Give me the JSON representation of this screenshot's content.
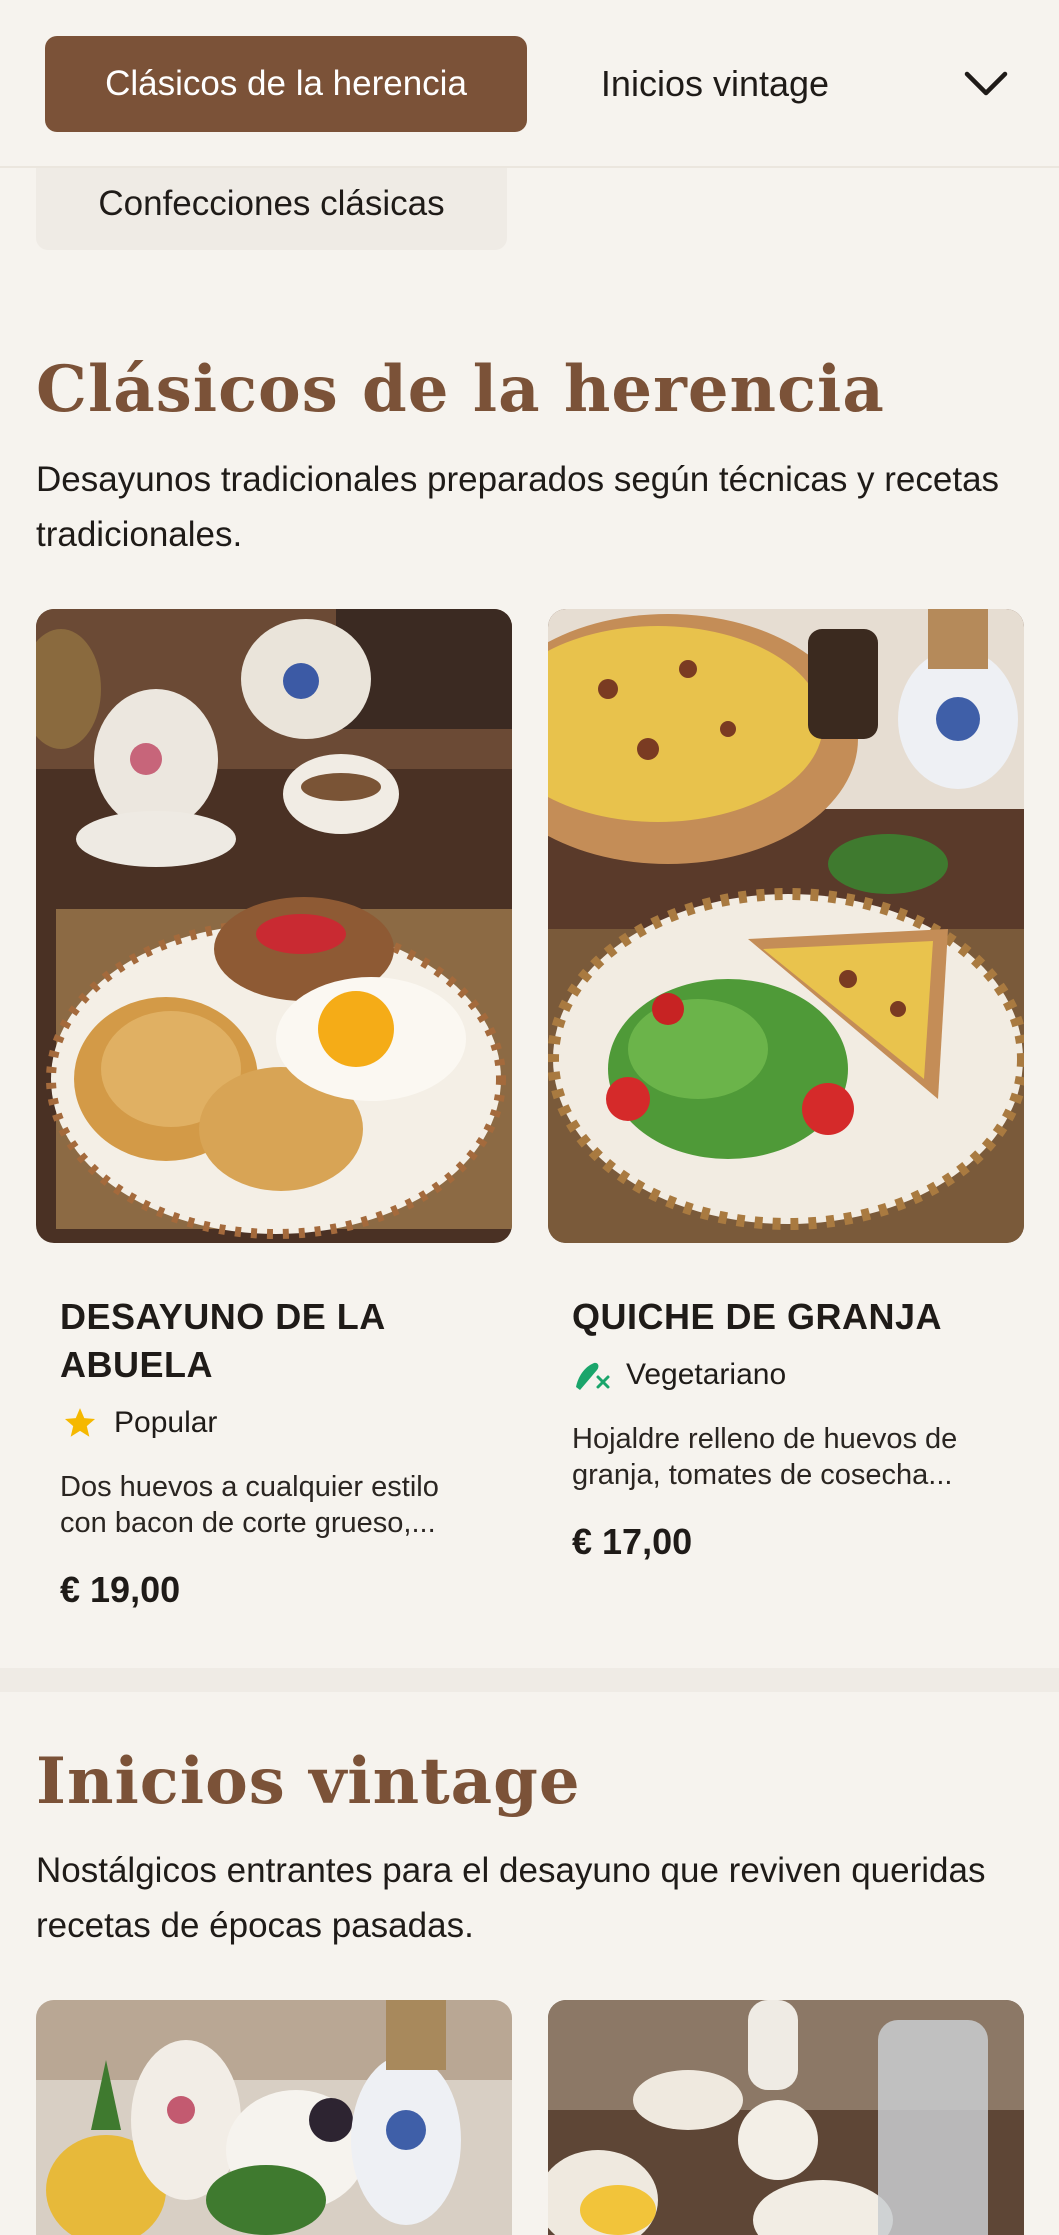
{
  "nav": {
    "active_tab": "Clásicos de la herencia",
    "tab_2": "Inicios vintage",
    "tab_3": "Confecciones clásicas",
    "expand_icon": "chevron-down-icon"
  },
  "sections": [
    {
      "title": "Clásicos de la herencia",
      "description": "Desayunos tradicionales preparados según técnicas y recetas tradicionales.",
      "items": [
        {
          "name": "DESAYUNO DE LA ABUELA",
          "tag": "Popular",
          "tag_icon": "star-icon",
          "tag_color": "#f5b800",
          "description": "Dos huevos a cualquier estilo con bacon de corte grueso,...",
          "price": "€ 19,00"
        },
        {
          "name": "QUICHE DE GRANJA",
          "tag": "Vegetariano",
          "tag_icon": "vegetarian-icon",
          "tag_color": "#1aa56b",
          "description": "Hojaldre relleno de huevos de granja, tomates de cosecha...",
          "price": "€ 17,00"
        }
      ]
    },
    {
      "title": "Inicios vintage",
      "description": "Nostálgicos entrantes para el desayuno que reviven queridas recetas de épocas pasadas."
    }
  ],
  "colors": {
    "accent": "#7b5238",
    "background": "#f6f3ee",
    "text": "#1f1b18"
  }
}
